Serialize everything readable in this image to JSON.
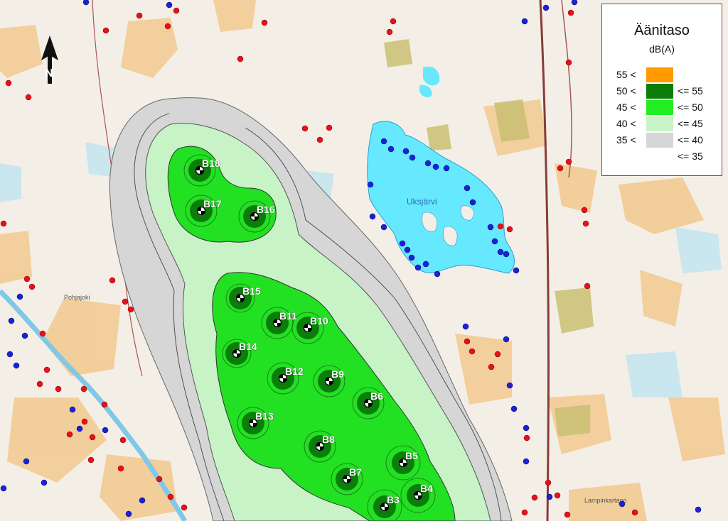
{
  "legend": {
    "title": "Äänitaso",
    "subtitle": "dB(A)",
    "rows": [
      {
        "left": "55 <",
        "right": "",
        "color": "#ff9a00"
      },
      {
        "left": "50 <",
        "right": "<= 55",
        "color": "#0b7d0b"
      },
      {
        "left": "45 <",
        "right": "<= 50",
        "color": "#22ee22"
      },
      {
        "left": "40 <",
        "right": "<= 45",
        "color": "#c7f3c7"
      },
      {
        "left": "35 <",
        "right": "<= 40",
        "color": "#d6d6d6"
      },
      {
        "left": "",
        "right": "<= 35",
        "color": ""
      }
    ]
  },
  "map": {
    "north_arrow_label": "N",
    "lake_label": "Uksjärvi",
    "place_labels": [
      "Pohjajoki",
      "Lampinkartano"
    ],
    "turbines": [
      "B3",
      "B4",
      "B5",
      "B6",
      "B7",
      "B8",
      "B9",
      "B10",
      "B11",
      "B12",
      "B13",
      "B14",
      "B15",
      "B16",
      "B17",
      "B18"
    ]
  }
}
